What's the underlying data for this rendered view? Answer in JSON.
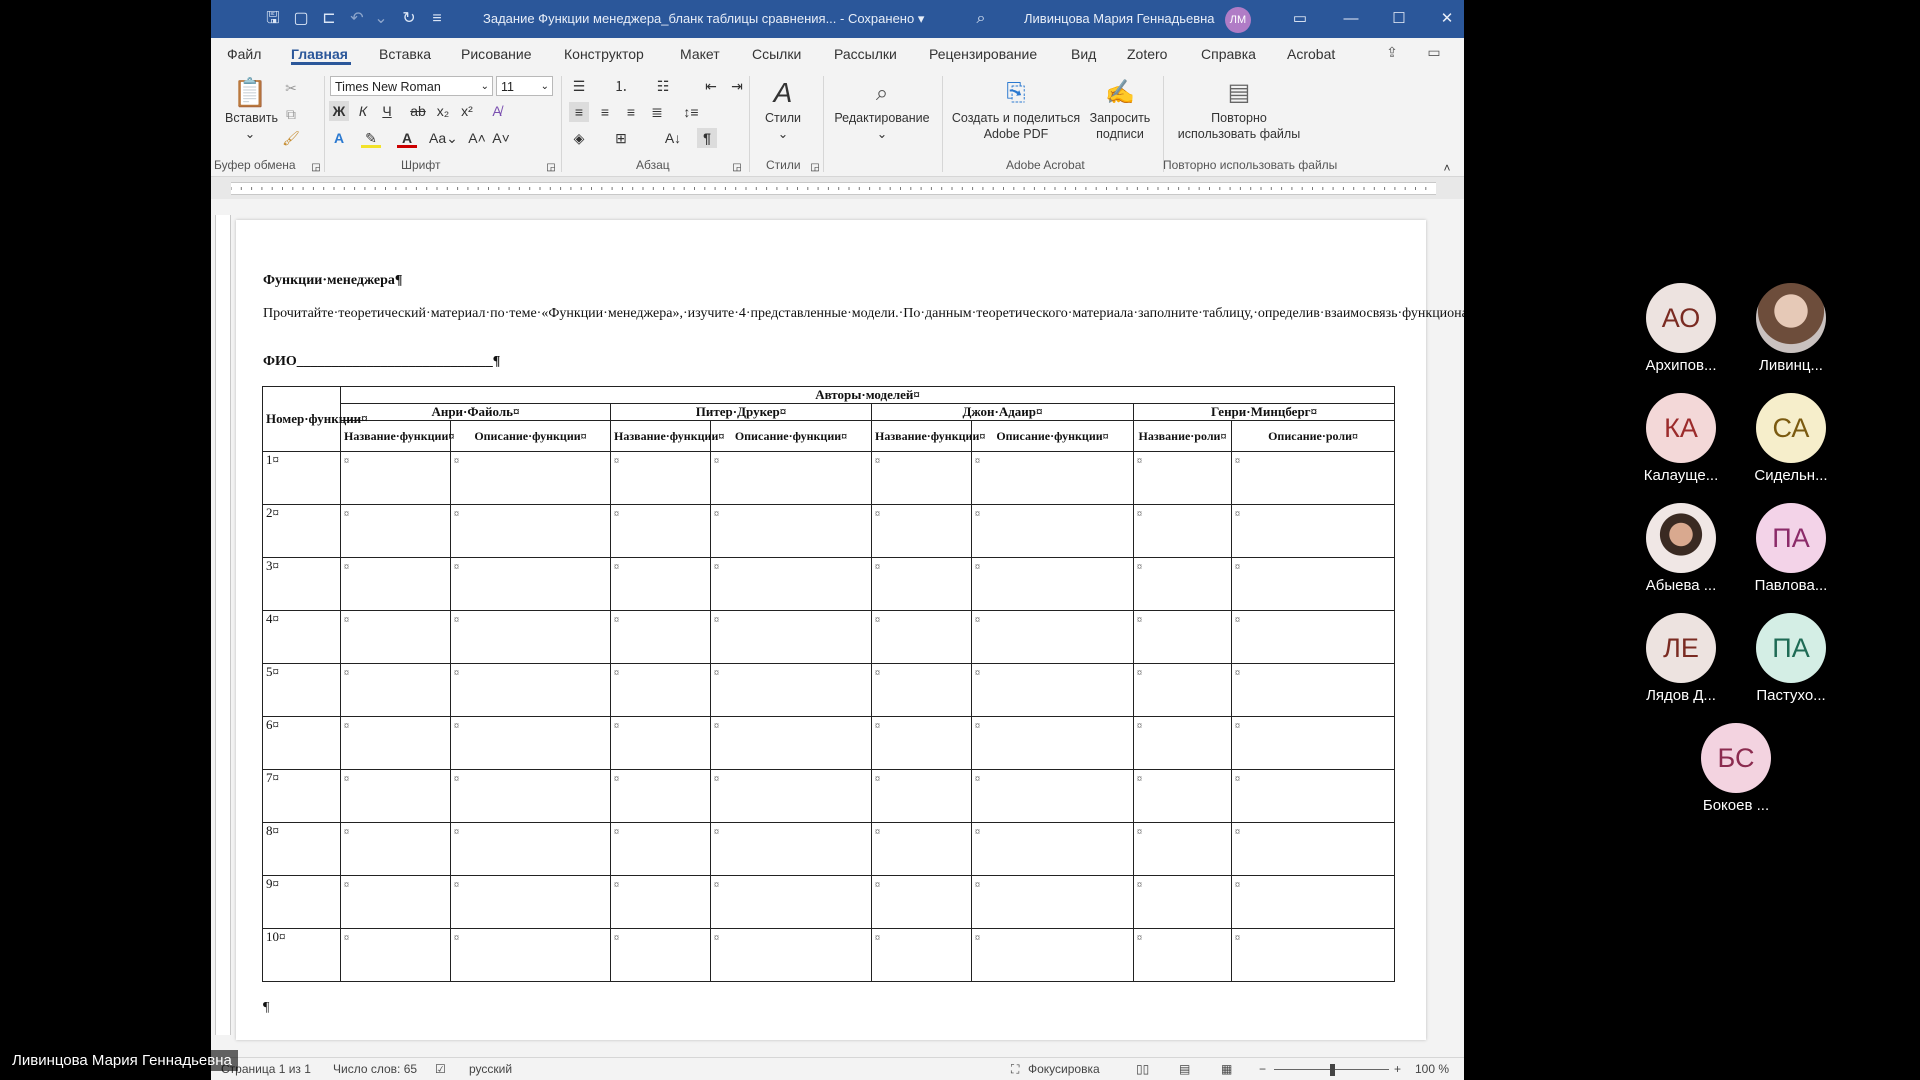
{
  "window": {
    "doc_title": "Задание Функции менеджера_бланк таблицы сравнения...  -  Сохранено  ▾",
    "user_name": "Ливинцова Мария Геннадьевна",
    "user_initials": "ЛМ",
    "accent": "#2b579a"
  },
  "tabs": [
    "Файл",
    "Главная",
    "Вставка",
    "Рисование",
    "Конструктор",
    "Макет",
    "Ссылки",
    "Рассылки",
    "Рецензирование",
    "Вид",
    "Zotero",
    "Справка",
    "Acrobat"
  ],
  "ribbon": {
    "paste_label": "Вставить",
    "group_clipboard": "Буфер обмена",
    "font_name": "Times New Roman",
    "font_size": "11",
    "group_font": "Шрифт",
    "group_paragraph": "Абзац",
    "styles_label": "Стили",
    "group_styles": "Стили",
    "editing_label": "Редактирование",
    "acrobat_create_1": "Создать и поделиться",
    "acrobat_create_2": "Adobe PDF",
    "acrobat_sign_1": "Запросить",
    "acrobat_sign_2": "подписи",
    "group_acrobat": "Adobe Acrobat",
    "reuse_1": "Повторно",
    "reuse_2": "использовать файлы",
    "group_reuse": "Повторно использовать файлы"
  },
  "document": {
    "heading": "Функции·менеджера¶",
    "intro": "Прочитайте·теоретический·материал·по·теме·«Функции·менеджера»,·изучите·4·представленные·модели.·По·данным·теоретического·материала·заполните·таблицу,·определив·взаимосвязь·функциональных·моделей·и·ролевой·модели.¶",
    "fio": "ФИО____________________________¶",
    "table": {
      "num_header": "Номер·функции¤",
      "authors_header": "Авторы·моделей¤",
      "authors": [
        "Анри·Файоль¤",
        "Питер·Друкер¤",
        "Джон·Адаир¤",
        "Генри·Минцберг¤"
      ],
      "sub_name": "Название·функции¤",
      "sub_desc": "Описание·функции¤",
      "sub_role_name": "Название·роли¤",
      "sub_role_desc": "Описание·роли¤",
      "rows": [
        "1¤",
        "2¤",
        "3¤",
        "4¤",
        "5¤",
        "6¤",
        "7¤",
        "8¤",
        "9¤",
        "10¤"
      ],
      "cell_mark": "¤"
    },
    "end_mark": "¶"
  },
  "status": {
    "page": "Страница 1 из 1",
    "words": "Число слов: 65",
    "lang": "русский",
    "focus": "Фокусировка",
    "zoom": "100 %",
    "zoom_level": 0.5
  },
  "speaker": "Ливинцова Мария Геннадьевна",
  "participants": [
    {
      "initials": "АО",
      "name": "Архипов...",
      "bg": "#ede3e0",
      "fg": "#7a2b22"
    },
    {
      "initials": "",
      "name": "Ливинц...",
      "bg": "photo",
      "fg": "#000"
    },
    {
      "initials": "КА",
      "name": "Калауще...",
      "bg": "#f3d8d8",
      "fg": "#9b2b2b"
    },
    {
      "initials": "СА",
      "name": "Сидельн...",
      "bg": "#f6eecb",
      "fg": "#7b5a10"
    },
    {
      "initials": "",
      "name": "Абыева ...",
      "bg": "photo2",
      "fg": "#000"
    },
    {
      "initials": "ПА",
      "name": "Павлова...",
      "bg": "#f3d3e8",
      "fg": "#8b2b69"
    },
    {
      "initials": "ЛЕ",
      "name": "Лядов Д...",
      "bg": "#ede3e0",
      "fg": "#7a2b22"
    },
    {
      "initials": "ПА",
      "name": "Пастухо...",
      "bg": "#d4eee5",
      "fg": "#1f6b55"
    },
    {
      "initials": "БС",
      "name": "Бокоев ...",
      "bg": "#f3d3e0",
      "fg": "#8b2b4f"
    }
  ]
}
